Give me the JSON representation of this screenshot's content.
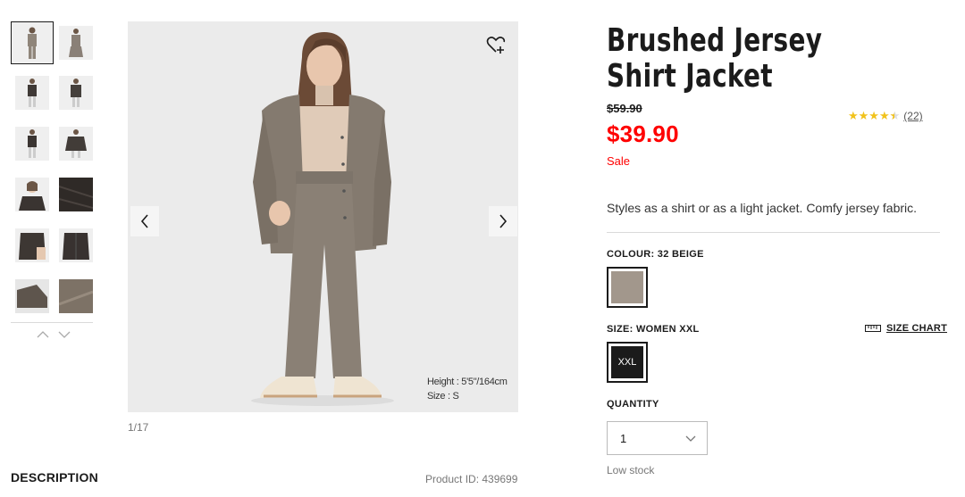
{
  "gallery": {
    "counter": "1/17",
    "model_info": {
      "height": "Height : 5'5\"/164cm",
      "size": "Size : S"
    },
    "thumbnails": [
      {
        "tone": "#8f857a"
      },
      {
        "tone": "#8a8077"
      },
      {
        "tone": "#3f3936"
      },
      {
        "tone": "#45403c"
      },
      {
        "tone": "#3b3532"
      },
      {
        "tone": "#423c38"
      },
      {
        "tone": "#3a3431"
      },
      {
        "tone": "#2f2a27"
      },
      {
        "tone": "#3d3733"
      },
      {
        "tone": "#383230"
      },
      {
        "tone": "#5e554d"
      },
      {
        "tone": "#7d7266"
      }
    ]
  },
  "product": {
    "title": "Brushed Jersey Shirt Jacket",
    "original_price": "$59.90",
    "sale_price": "$39.90",
    "sale_label": "Sale",
    "rating": {
      "value": 4.5,
      "count": "(22)"
    },
    "tagline": "Styles as a shirt or as a light jacket. Comfy jersey fabric.",
    "colour_label": "COLOUR: 32 BEIGE",
    "colour_swatch": "#a2978c",
    "size_label": "SIZE: WOMEN XXL",
    "size_chart": "SIZE CHART",
    "selected_size": "XXL",
    "quantity_label": "QUANTITY",
    "quantity_value": "1",
    "stock": "Low stock",
    "product_id": "Product ID: 439699"
  },
  "description": {
    "heading": "DESCRIPTION"
  },
  "colors": {
    "sale": "#ff0000",
    "star": "#f1c21b",
    "text": "#1b1b1b"
  }
}
